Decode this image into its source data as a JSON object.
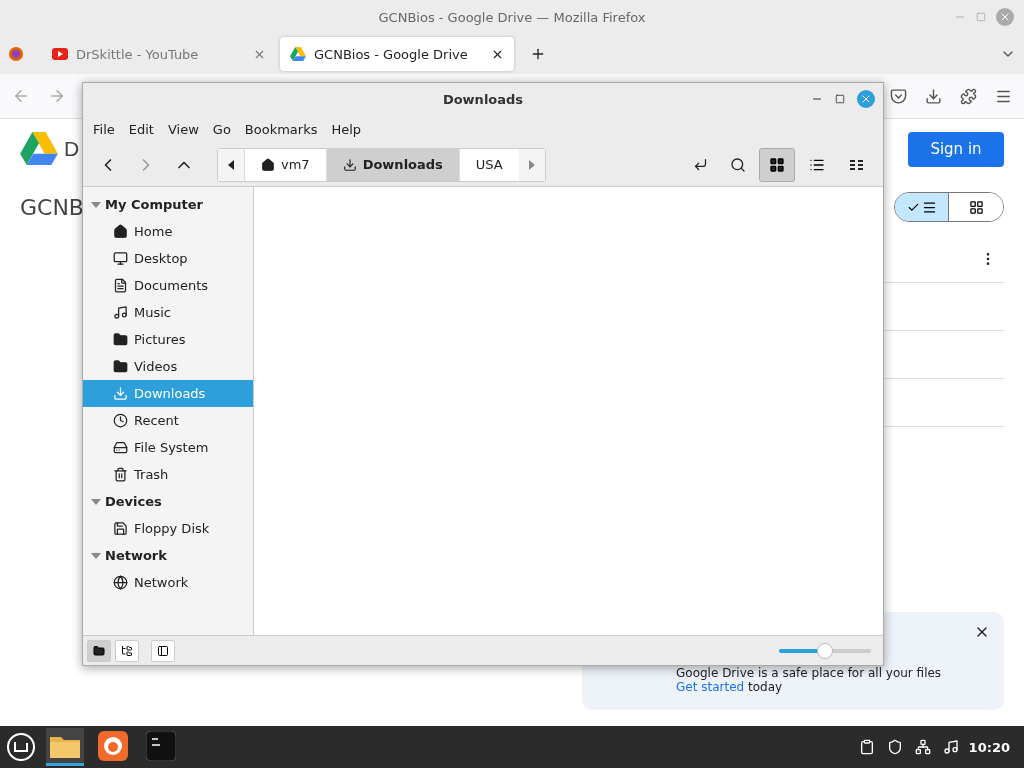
{
  "firefox": {
    "title": "GCNBios - Google Drive — Mozilla Firefox",
    "tabs": [
      {
        "title": "DrSkittle - YouTube",
        "kind": "youtube",
        "selected": false
      },
      {
        "title": "GCNBios - Google Drive",
        "kind": "drive",
        "selected": true
      }
    ],
    "page": {
      "logo_text": "D",
      "heading": "GCNB",
      "sign_in": "Sign in",
      "view_toggle": [
        {
          "kind": "list",
          "selected": true
        },
        {
          "kind": "grid",
          "selected": false
        }
      ],
      "notification": {
        "text": "Google Drive is a safe place for all your files",
        "link": "Get started",
        "rest": " today"
      }
    }
  },
  "file_manager": {
    "title": "Downloads",
    "menu": [
      "File",
      "Edit",
      "View",
      "Go",
      "Bookmarks",
      "Help"
    ],
    "path": [
      {
        "label": "vm7",
        "kind": "home",
        "selected": false
      },
      {
        "label": "Downloads",
        "kind": "download",
        "selected": true
      },
      {
        "label": "USA",
        "kind": "plain",
        "selected": false
      }
    ],
    "view_buttons": [
      {
        "kind": "icons",
        "selected": true
      },
      {
        "kind": "list",
        "selected": false
      },
      {
        "kind": "compact",
        "selected": false
      }
    ],
    "sidebar": [
      {
        "label": "My Computer",
        "expanded": true,
        "children": [
          {
            "label": "Home",
            "kind": "home",
            "selected": false
          },
          {
            "label": "Desktop",
            "kind": "desktop",
            "selected": false
          },
          {
            "label": "Documents",
            "kind": "document",
            "selected": false
          },
          {
            "label": "Music",
            "kind": "music",
            "selected": false
          },
          {
            "label": "Pictures",
            "kind": "folder",
            "selected": false
          },
          {
            "label": "Videos",
            "kind": "folder",
            "selected": false
          },
          {
            "label": "Downloads",
            "kind": "download",
            "selected": true
          },
          {
            "label": "Recent",
            "kind": "recent",
            "selected": false
          },
          {
            "label": "File System",
            "kind": "drive",
            "selected": false
          },
          {
            "label": "Trash",
            "kind": "trash",
            "selected": false
          }
        ]
      },
      {
        "label": "Devices",
        "expanded": true,
        "children": [
          {
            "label": "Floppy Disk",
            "kind": "floppy",
            "selected": false
          }
        ]
      },
      {
        "label": "Network",
        "expanded": true,
        "children": [
          {
            "label": "Network",
            "kind": "network",
            "selected": false
          }
        ]
      }
    ],
    "bottom_buttons": [
      {
        "kind": "places",
        "selected": true
      },
      {
        "kind": "tree",
        "selected": false
      },
      {
        "kind": "hide",
        "selected": false
      }
    ],
    "zoom": {
      "level": 0.5
    }
  },
  "taskbar": {
    "apps": [
      {
        "kind": "files",
        "selected": true
      },
      {
        "kind": "firefox",
        "selected": false
      },
      {
        "kind": "terminal",
        "selected": false
      }
    ],
    "clock": "10:20"
  }
}
